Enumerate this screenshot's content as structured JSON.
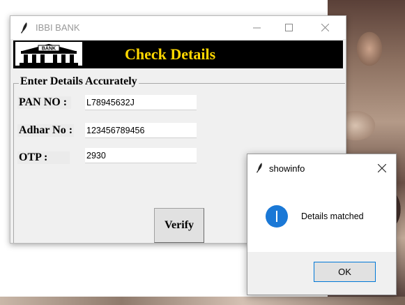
{
  "main_window": {
    "title": "IBBI BANK",
    "banner_title": "Check Details",
    "logo_text": "BANK",
    "group_label": "Enter Details Accurately",
    "fields": [
      {
        "label": "PAN NO :",
        "value": "L78945632J"
      },
      {
        "label": "Adhar No :",
        "value": "123456789456"
      },
      {
        "label": "OTP :",
        "value": "2930"
      }
    ],
    "verify_label": "Verify"
  },
  "dialog": {
    "title": "showinfo",
    "message": "Details matched",
    "ok_label": "OK",
    "icon": "info-icon"
  },
  "colors": {
    "banner_bg": "#000000",
    "banner_text": "#ffd800",
    "info_icon": "#1a78d6",
    "ok_border": "#0078d7"
  }
}
